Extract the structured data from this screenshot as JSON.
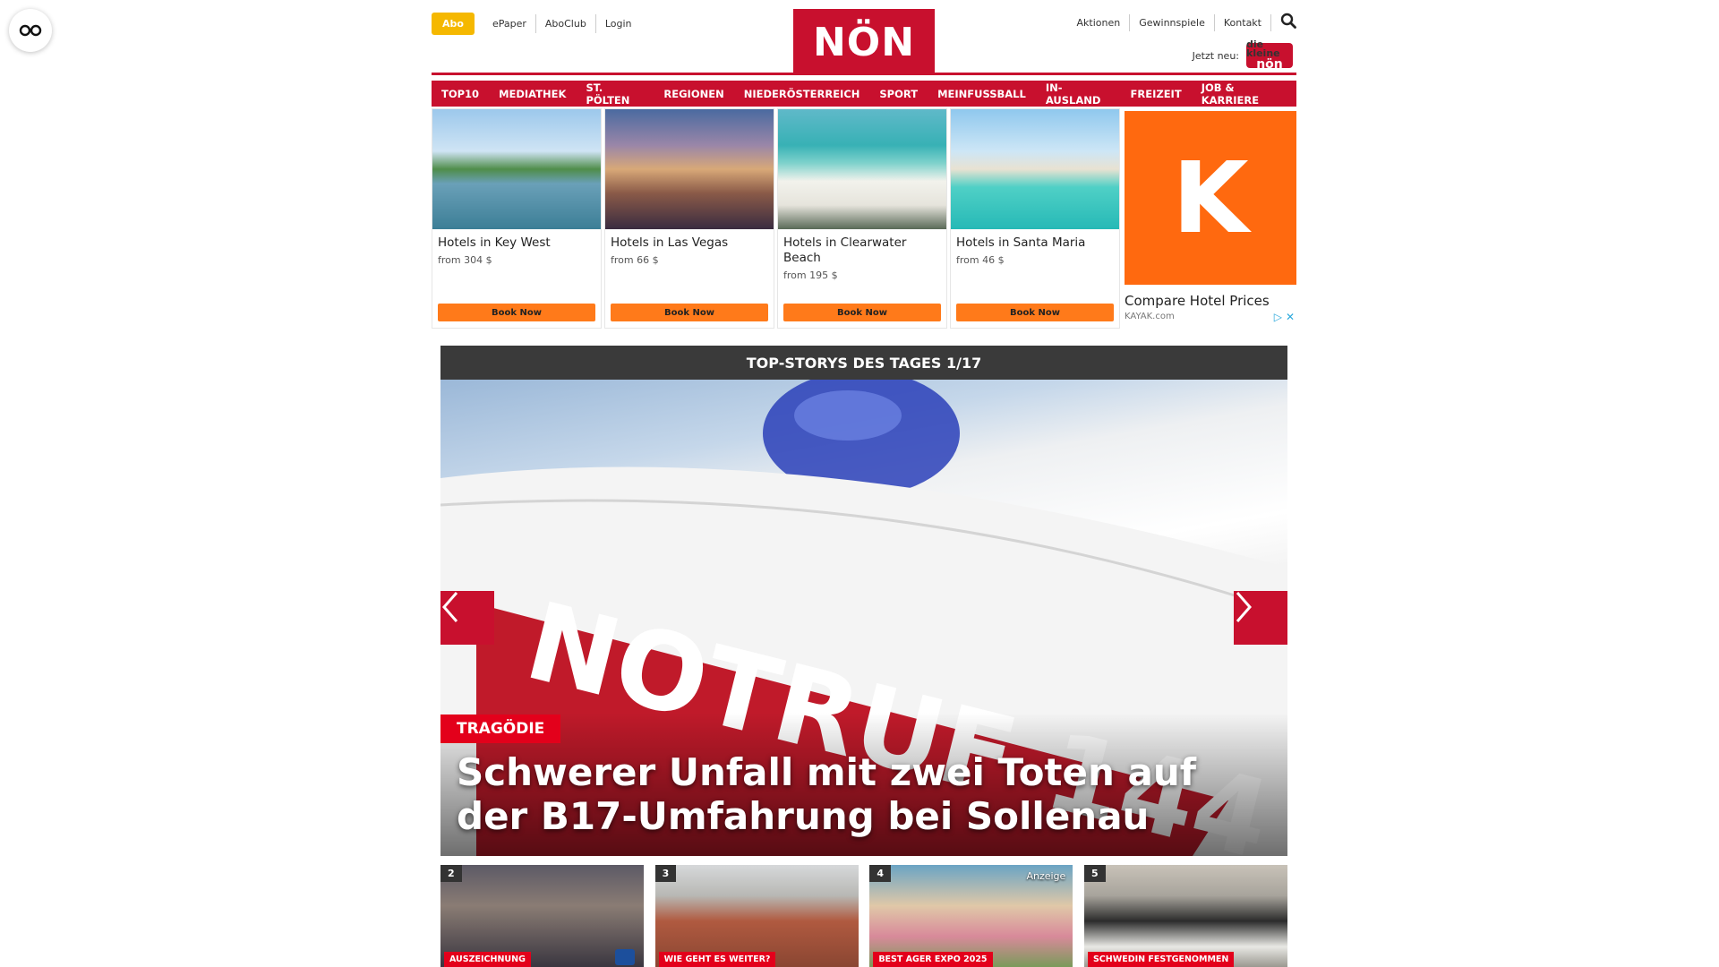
{
  "topbar": {
    "abo": "Abo",
    "links": [
      "ePaper",
      "AboClub",
      "Login"
    ],
    "logo": "NÖN",
    "right_links": [
      "Aktionen",
      "Gewinnspiele",
      "Kontakt"
    ],
    "jetzt_neu": "Jetzt neu:",
    "kleine_top": "die kleine",
    "kleine_bottom": "nön"
  },
  "nav": [
    "TOP10",
    "MEDIATHEK",
    "ST. PÖLTEN",
    "REGIONEN",
    "NIEDERÖSTERREICH",
    "SPORT",
    "MEINFUSSBALL",
    "IN-AUSLAND",
    "FREIZEIT",
    "JOB & KARRIERE"
  ],
  "ad": {
    "cards": [
      {
        "title": "Hotels in Key West",
        "price": "from 304 $",
        "button": "Book Now"
      },
      {
        "title": "Hotels in Las Vegas",
        "price": "from 66 $",
        "button": "Book Now"
      },
      {
        "title": "Hotels in Clearwater Beach",
        "price": "from 195 $",
        "button": "Book Now"
      },
      {
        "title": "Hotels in Santa Maria",
        "price": "from 46 $",
        "button": "Book Now"
      }
    ],
    "kayak_letter": "K",
    "kayak_title": "Compare Hotel Prices",
    "kayak_domain": "KAYAK.com",
    "adchoice_icon": "▷",
    "adchoice_close": "✕"
  },
  "stories": {
    "header": "TOP-STORYS DES TAGES 1/17",
    "hero_tag": "TRAGÖDIE",
    "hero_headline": "Schwerer Unfall mit zwei Toten auf der B17-Umfahrung bei Sollenau",
    "hero_vehicle_text": "NOTRUF 144",
    "thumbs": [
      {
        "num": "2",
        "tag": "AUSZEICHNUNG",
        "anz": ""
      },
      {
        "num": "3",
        "tag": "WIE GEHT ES WEITER?",
        "anz": ""
      },
      {
        "num": "4",
        "tag": "BEST AGER EXPO 2025",
        "anz": "Anzeige"
      },
      {
        "num": "5",
        "tag": "SCHWEDIN FESTGENOMMEN",
        "anz": ""
      }
    ]
  },
  "colors": {
    "brand_red": "#c8102e",
    "abo_yellow": "#f5b800",
    "kayak_orange": "#ff690f",
    "book_orange": "#ff7a1a"
  }
}
